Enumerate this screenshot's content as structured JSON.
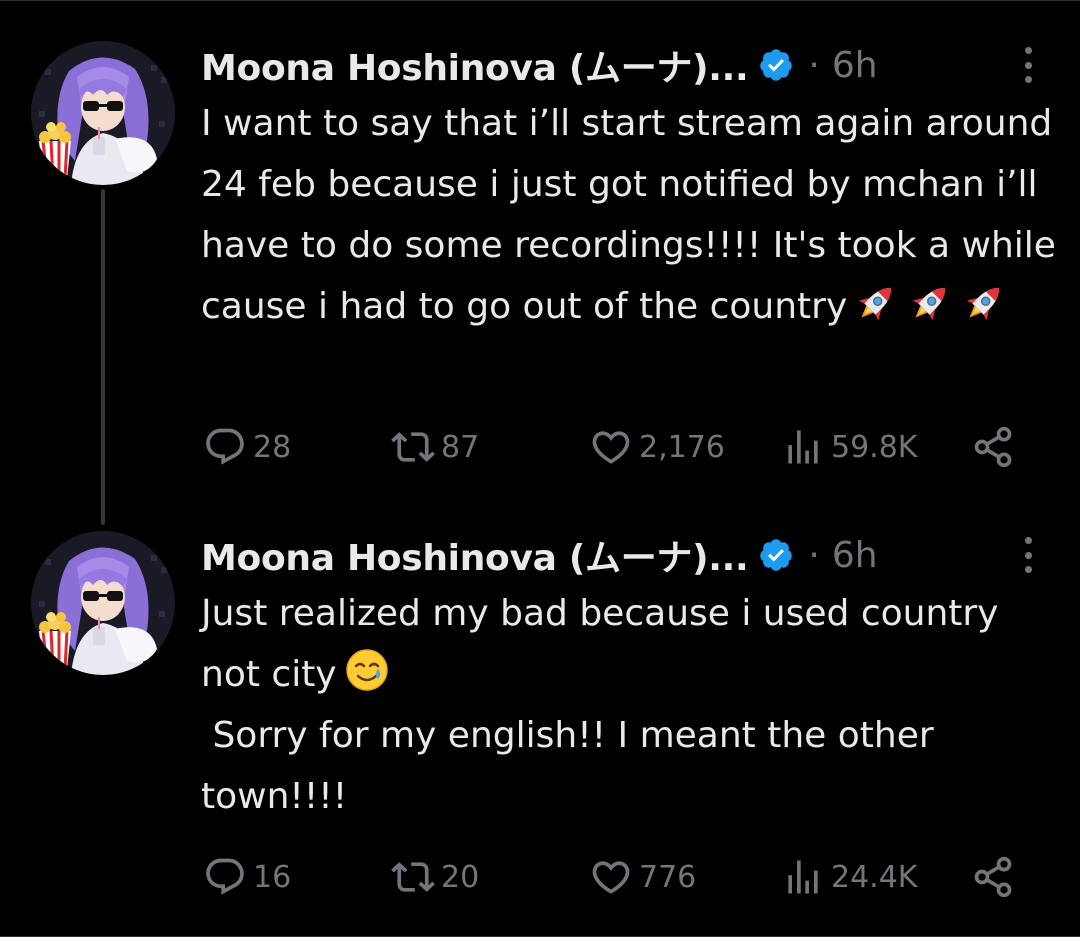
{
  "colors": {
    "background": "#000000",
    "text_primary": "#e7e9ea",
    "text_secondary": "#71767b",
    "verified_badge": "#1d9bf0",
    "thread_line": "#333639"
  },
  "tweets": [
    {
      "author": {
        "name": "Moona Hoshinova (ムーナ)...",
        "avatar_icon": "avatar-purple-hair-sunglasses-popcorn",
        "verified_icon": "verified-badge-icon"
      },
      "separator": "·",
      "time": "6h",
      "text": "I want to say that i’ll start stream again around 24 feb because i just got notified by mchan i’ll have to do some recordings!!!! It's took a while cause i had to go out of the country",
      "emojis": [
        "rocket",
        "rocket",
        "rocket"
      ],
      "metrics": {
        "replies": "28",
        "retweets": "87",
        "likes": "2,176",
        "views": "59.8K"
      }
    },
    {
      "author": {
        "name": "Moona Hoshinova (ムーナ)...",
        "avatar_icon": "avatar-purple-hair-sunglasses-popcorn",
        "verified_icon": "verified-badge-icon"
      },
      "separator": "·",
      "time": "6h",
      "text_line_1": "Just realized my bad because i used country not city",
      "text_line_2": " Sorry for my english!! I meant the other town!!!!",
      "emojis": [
        "smiling-face-with-tear"
      ],
      "metrics": {
        "replies": "16",
        "retweets": "20",
        "likes": "776",
        "views": "24.4K"
      }
    }
  ]
}
